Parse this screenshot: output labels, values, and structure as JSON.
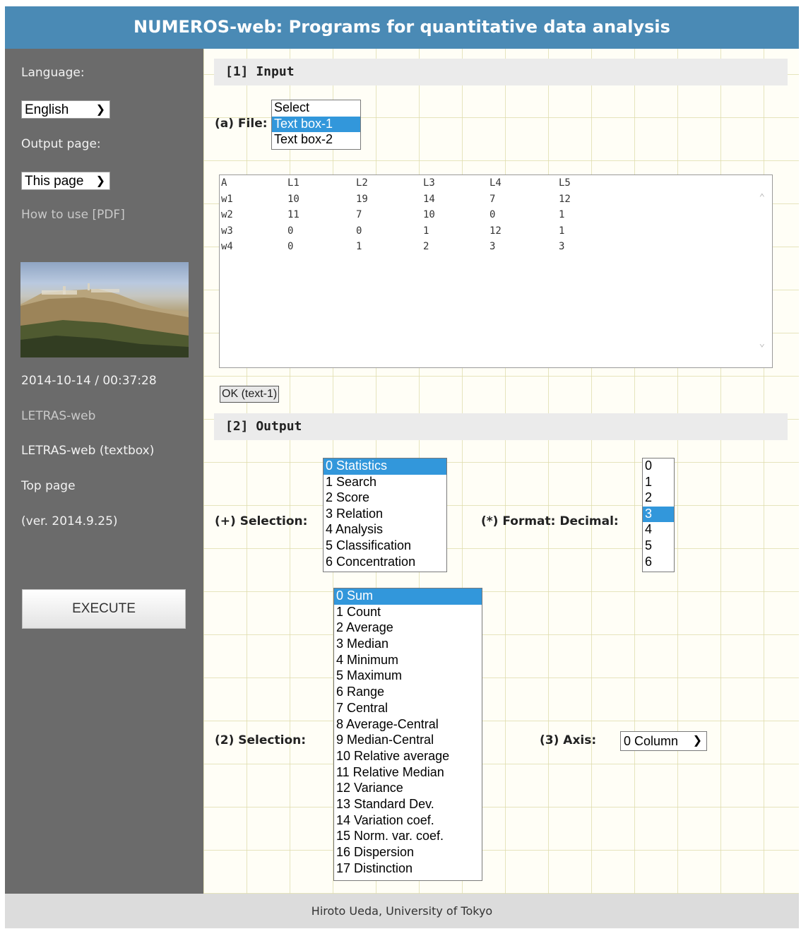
{
  "header": {
    "title": "NUMEROS-web: Programs for quantitative data analysis"
  },
  "sidebar": {
    "language_label": "Language:",
    "language_value": "English",
    "output_page_label": "Output page:",
    "output_page_value": "This page",
    "how_to_use": "How to use [PDF]",
    "datetime": "2014-10-14 / 00:37:28",
    "link_letras": "LETRAS-web",
    "link_letras_textbox": "LETRAS-web (textbox)",
    "link_top_page": "Top page",
    "version": "(ver. 2014.9.25)",
    "execute_label": "EXECUTE"
  },
  "input": {
    "section_title": "[1] Input",
    "file_label": "(a) File:",
    "file_options": [
      "Select",
      "Text box-1",
      "Text box-2"
    ],
    "file_selected_index": 1,
    "textarea_rows": [
      [
        "A",
        "L1",
        "L2",
        "L3",
        "L4",
        "L5"
      ],
      [
        "w1",
        "10",
        "19",
        "14",
        "7",
        "12"
      ],
      [
        "w2",
        "11",
        "7",
        "10",
        "0",
        "1"
      ],
      [
        "w3",
        "0",
        "0",
        "1",
        "12",
        "1"
      ],
      [
        "w4",
        "0",
        "1",
        "2",
        "3",
        "3"
      ]
    ],
    "ok_button": "OK (text-1)"
  },
  "output": {
    "section_title": "[2] Output",
    "selection1_label": "(+) Selection:",
    "selection1_options": [
      "0 Statistics",
      "1 Search",
      "2 Score",
      "3 Relation",
      "4 Analysis",
      "5 Classification",
      "6 Concentration"
    ],
    "selection1_selected_index": 0,
    "format_label": "(*) Format: Decimal:",
    "decimal_options": [
      "0",
      "1",
      "2",
      "3",
      "4",
      "5",
      "6"
    ],
    "decimal_selected_index": 3,
    "selection2_label": "(2) Selection:",
    "selection2_options": [
      "0 Sum",
      "1 Count",
      "2 Average",
      "3 Median",
      "4 Minimum",
      "5 Maximum",
      "6 Range",
      "7 Central",
      "8 Average-Central",
      "9 Median-Central",
      "10 Relative average",
      "11 Relative Median",
      "12 Variance",
      "13 Standard Dev.",
      "14 Variation coef.",
      "15 Norm. var. coef.",
      "16 Dispersion",
      "17 Distinction"
    ],
    "selection2_selected_index": 0,
    "axis_label": "(3) Axis:",
    "axis_value": "0 Column"
  },
  "footer": {
    "text": "Hiroto Ueda, University of Tokyo"
  },
  "colors": {
    "header_bg": "#4a8ab5",
    "sidebar_bg": "#6b6b6b",
    "selected_option": "#3297db"
  }
}
